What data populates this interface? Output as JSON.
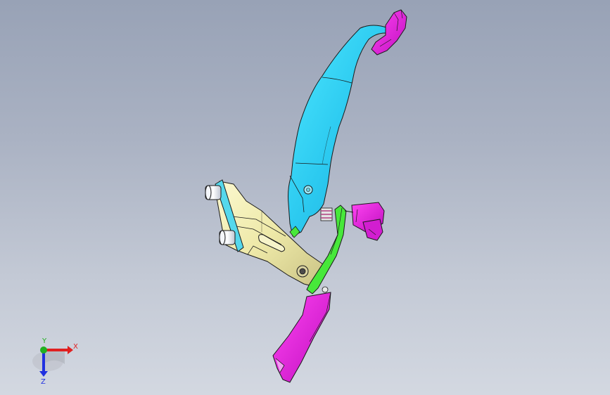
{
  "view": {
    "colors": {
      "background_top": "#98a2b6",
      "background_bottom": "#d3d8e1",
      "pedal_arm": "#33d6f5",
      "mounting_bracket": "#eee9a8",
      "link_bar": "#47e83a",
      "end_fittings": "#e81fe0",
      "bushings": "#eef1f7",
      "edge_lines": "#1a1a1a"
    }
  },
  "triad": {
    "x_label": "X",
    "y_label": "Y",
    "z_label": "Z",
    "x_color": "#e02020",
    "y_color": "#20b020",
    "z_color": "#2030e0"
  }
}
